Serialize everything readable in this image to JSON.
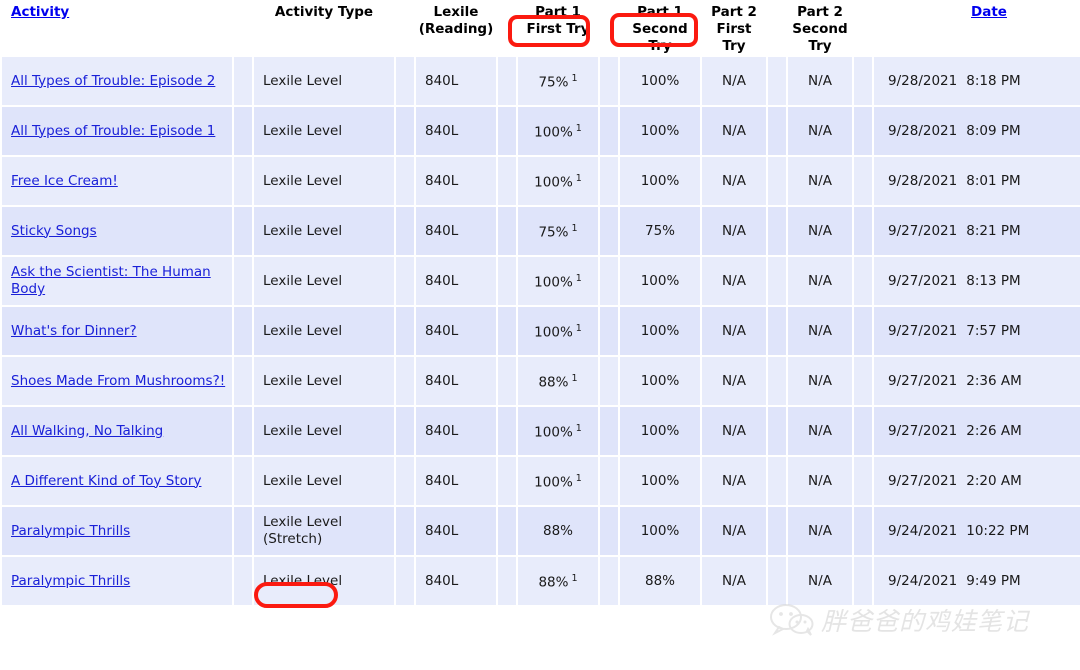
{
  "table": {
    "columns": [
      {
        "key": "activity",
        "label": "Activity",
        "link": true,
        "align": "left"
      },
      {
        "key": "type",
        "label": "Activity Type",
        "link": false,
        "align": "center"
      },
      {
        "key": "lexile",
        "label": "Lexile\n(Reading)",
        "label_line1": "Lexile",
        "label_line2": "(Reading)",
        "link": false,
        "align": "center"
      },
      {
        "key": "p1first",
        "label_line1": "Part 1",
        "label_line2": "First Try",
        "link": false,
        "align": "center"
      },
      {
        "key": "p1second",
        "label_line1": "Part 1",
        "label_line2": "Second Try",
        "link": false,
        "align": "center"
      },
      {
        "key": "p2first",
        "label_line1": "Part 2",
        "label_line2": "First",
        "label_line3": "Try",
        "link": false,
        "align": "center"
      },
      {
        "key": "p2second",
        "label_line1": "Part 2",
        "label_line2": "Second",
        "label_line3": "Try",
        "link": false,
        "align": "center"
      },
      {
        "key": "date",
        "label": "Date",
        "link": true,
        "align": "center"
      }
    ],
    "headers": {
      "activity": "Activity",
      "activity_type": "Activity Type",
      "lexile_l1": "Lexile",
      "lexile_l2": "(Reading)",
      "part1_l1": "Part 1",
      "part1_first_try": "First Try",
      "part1b_l1": "Part 1",
      "part1_second_try": "Second Try",
      "part2_l1": "Part 2",
      "part2_first_l2": "First",
      "part2_first_l3": "Try",
      "part2b_l1": "Part 2",
      "part2_second_l2": "Second",
      "part2_second_l3": "Try",
      "date": "Date"
    },
    "rows": [
      {
        "activity": "All Types of Trouble: Episode 2",
        "type": "Lexile Level",
        "type_note": "",
        "lexile": "840L",
        "p1_first": "75%",
        "p1_first_marker": "1",
        "p1_second": "100%",
        "p2_first": "N/A",
        "p2_second": "N/A",
        "date": "9/28/2021",
        "time": "8:18 PM"
      },
      {
        "activity": "All Types of Trouble: Episode 1",
        "type": "Lexile Level",
        "type_note": "",
        "lexile": "840L",
        "p1_first": "100%",
        "p1_first_marker": "1",
        "p1_second": "100%",
        "p2_first": "N/A",
        "p2_second": "N/A",
        "date": "9/28/2021",
        "time": "8:09 PM"
      },
      {
        "activity": "Free Ice Cream!",
        "type": "Lexile Level",
        "type_note": "",
        "lexile": "840L",
        "p1_first": "100%",
        "p1_first_marker": "1",
        "p1_second": "100%",
        "p2_first": "N/A",
        "p2_second": "N/A",
        "date": "9/28/2021",
        "time": "8:01 PM"
      },
      {
        "activity": "Sticky Songs",
        "type": "Lexile Level",
        "type_note": "",
        "lexile": "840L",
        "p1_first": "75%",
        "p1_first_marker": "1",
        "p1_second": "75%",
        "p2_first": "N/A",
        "p2_second": "N/A",
        "date": "9/27/2021",
        "time": "8:21 PM"
      },
      {
        "activity": "Ask the Scientist: The Human Body",
        "type": "Lexile Level",
        "type_note": "",
        "lexile": "840L",
        "p1_first": "100%",
        "p1_first_marker": "1",
        "p1_second": "100%",
        "p2_first": "N/A",
        "p2_second": "N/A",
        "date": "9/27/2021",
        "time": "8:13 PM"
      },
      {
        "activity": "What's for Dinner?",
        "type": "Lexile Level",
        "type_note": "",
        "lexile": "840L",
        "p1_first": "100%",
        "p1_first_marker": "1",
        "p1_second": "100%",
        "p2_first": "N/A",
        "p2_second": "N/A",
        "date": "9/27/2021",
        "time": "7:57 PM"
      },
      {
        "activity": "Shoes Made From Mushrooms?!",
        "type": "Lexile Level",
        "type_note": "",
        "lexile": "840L",
        "p1_first": "88%",
        "p1_first_marker": "1",
        "p1_second": "100%",
        "p2_first": "N/A",
        "p2_second": "N/A",
        "date": "9/27/2021",
        "time": "2:36 AM"
      },
      {
        "activity": "All Walking, No Talking",
        "type": "Lexile Level",
        "type_note": "",
        "lexile": "840L",
        "p1_first": "100%",
        "p1_first_marker": "1",
        "p1_second": "100%",
        "p2_first": "N/A",
        "p2_second": "N/A",
        "date": "9/27/2021",
        "time": "2:26 AM"
      },
      {
        "activity": "A Different Kind of Toy Story",
        "type": "Lexile Level",
        "type_note": "",
        "lexile": "840L",
        "p1_first": "100%",
        "p1_first_marker": "1",
        "p1_second": "100%",
        "p2_first": "N/A",
        "p2_second": "N/A",
        "date": "9/27/2021",
        "time": "2:20 AM"
      },
      {
        "activity": "Paralympic Thrills",
        "type": "Lexile Level",
        "type_note": "(Stretch)",
        "lexile": "840L",
        "p1_first": "88%",
        "p1_first_marker": "",
        "p1_second": "100%",
        "p2_first": "N/A",
        "p2_second": "N/A",
        "date": "9/24/2021",
        "time": "10:22 PM"
      },
      {
        "activity": "Paralympic Thrills",
        "type": "Lexile Level",
        "type_note": "",
        "lexile": "840L",
        "p1_first": "88%",
        "p1_first_marker": "1",
        "p1_second": "88%",
        "p2_first": "N/A",
        "p2_second": "N/A",
        "date": "9/24/2021",
        "time": "9:49 PM"
      }
    ]
  },
  "annotations": [
    {
      "id": "first-try",
      "shape": "rounded-rect",
      "target": "First Try",
      "color": "#fb1a10"
    },
    {
      "id": "second-try",
      "shape": "rounded-rect",
      "target": "Second Try",
      "color": "#fb1a10"
    },
    {
      "id": "stretch",
      "shape": "oval",
      "target": "(Stretch)",
      "color": "#fb1a10"
    }
  ],
  "watermark": {
    "text": "胖爸爸的鸡娃笔记",
    "icon": "wechat-icon",
    "color": "#cfcfcf"
  },
  "colors": {
    "row_light": "#e8ecfb",
    "row_dark": "#dfe4fa",
    "link": "#1a20d8",
    "header_link": "#0000EE",
    "annotation_red": "#fb1a10",
    "page_background": "#ffffff"
  }
}
